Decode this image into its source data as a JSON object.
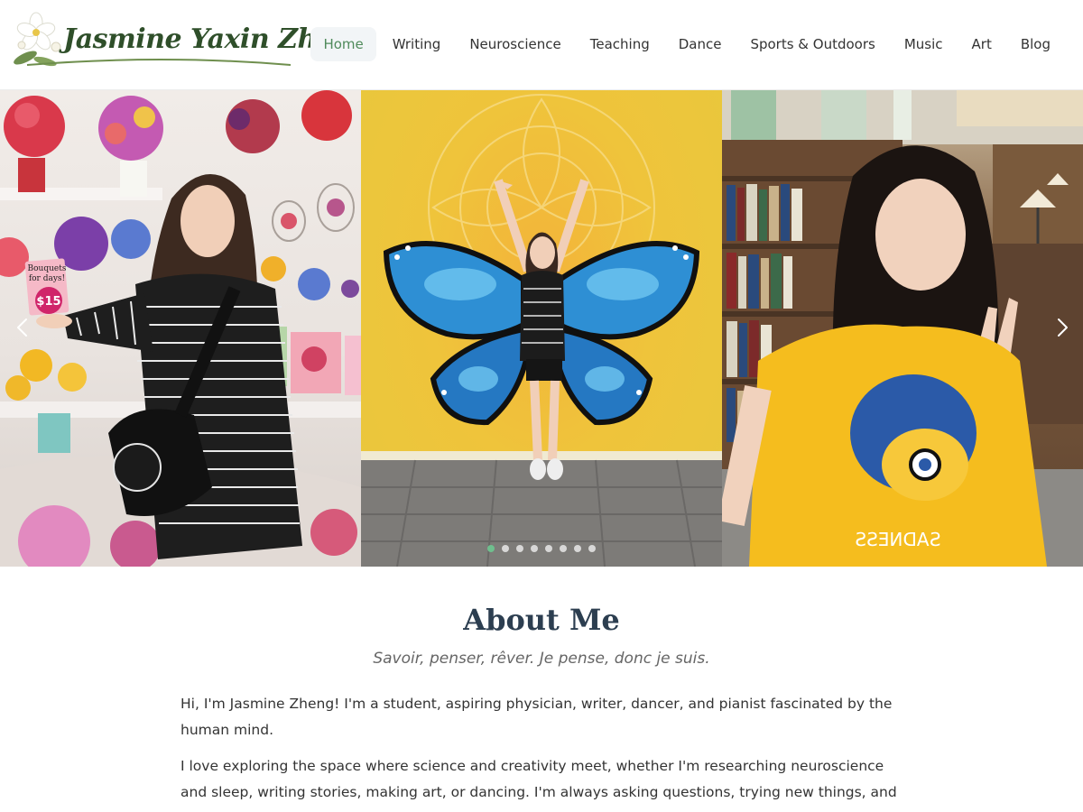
{
  "site": {
    "logo_text": "Jasmine Yaxin Zheng"
  },
  "nav": {
    "items": [
      {
        "label": "Home",
        "active": true
      },
      {
        "label": "Writing",
        "active": false
      },
      {
        "label": "Neuroscience",
        "active": false
      },
      {
        "label": "Teaching",
        "active": false
      },
      {
        "label": "Dance",
        "active": false
      },
      {
        "label": "Sports & Outdoors",
        "active": false
      },
      {
        "label": "Music",
        "active": false
      },
      {
        "label": "Art",
        "active": false
      },
      {
        "label": "Blog",
        "active": false
      }
    ]
  },
  "carousel": {
    "sign_text_line1": "Bouquets",
    "sign_text_line2": "for days!",
    "sign_price": "$15",
    "shirt_text": "SADNESS",
    "icons": {
      "prev": "chevron-left-icon",
      "next": "chevron-right-icon"
    },
    "slide_count": 8,
    "active_slide": 1,
    "active_dot_color": "#6fbf8e"
  },
  "about": {
    "title": "About Me",
    "subtitle": "Savoir, penser, rêver. Je pense, donc je suis.",
    "paragraph1": "Hi, I'm Jasmine Zheng! I'm a student, aspiring physician, writer, dancer, and pianist fascinated by the human mind.",
    "paragraph2": "I love exploring the space where science and creativity meet, whether I'm researching neuroscience and sleep, writing stories, making art, or dancing. I'm always asking questions, trying new things, and finding"
  },
  "colors": {
    "accent": "#4f8a5b",
    "heading": "#2c3e50",
    "nav_active_bg": "#f2f5f7"
  }
}
